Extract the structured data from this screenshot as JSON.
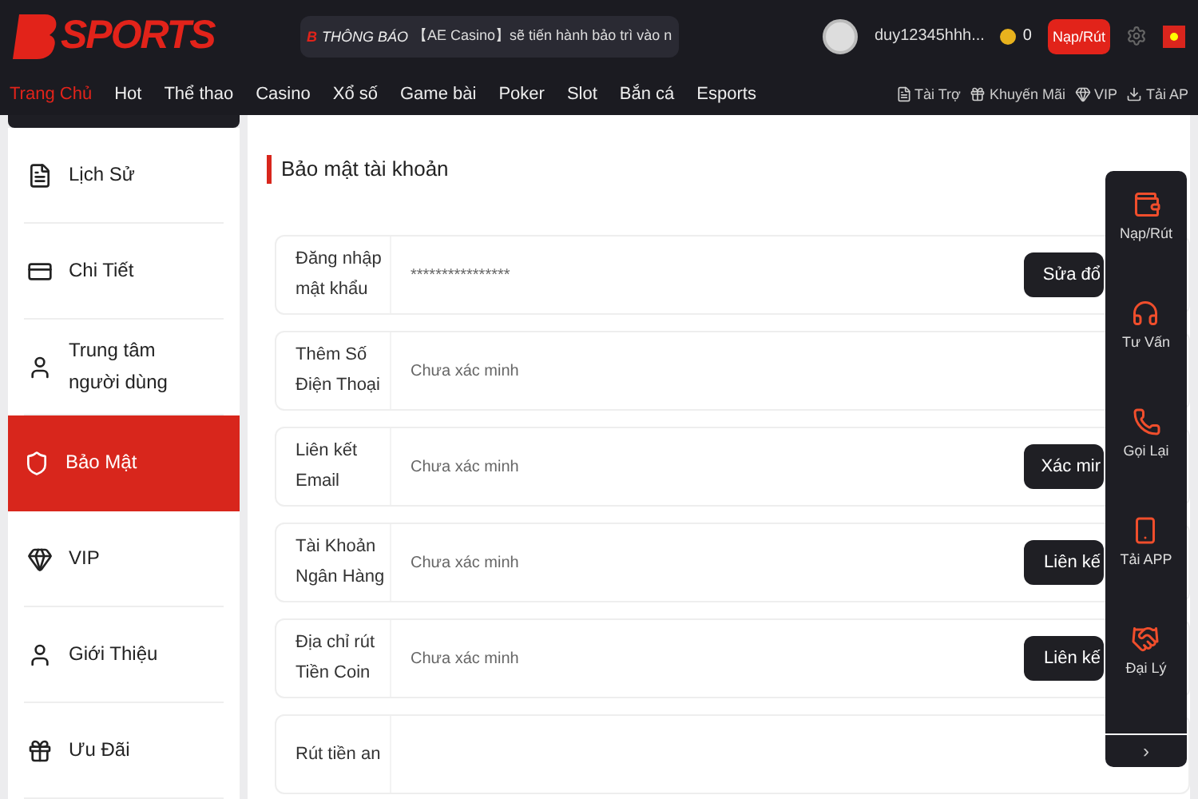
{
  "header": {
    "logo": "SPORTS",
    "notice": {
      "mark": "B",
      "label": "THÔNG BÁO",
      "text": "【AE Casino】sẽ tiến hành bảo trì vào n"
    },
    "username": "duy12345hhh...",
    "balance": "0",
    "deposit_button": "Nạp/Rút"
  },
  "nav": {
    "items": [
      {
        "label": "Trang Chủ",
        "selected": true
      },
      {
        "label": "Hot",
        "selected": false
      },
      {
        "label": "Thể thao",
        "selected": false
      },
      {
        "label": "Casino",
        "selected": false
      },
      {
        "label": "Xổ số",
        "selected": false
      },
      {
        "label": "Game bài",
        "selected": false
      },
      {
        "label": "Poker",
        "selected": false
      },
      {
        "label": "Slot",
        "selected": false
      },
      {
        "label": "Bắn cá",
        "selected": false
      },
      {
        "label": "Esports",
        "selected": false
      }
    ],
    "links": [
      "Tài Trợ",
      "Khuyến Mãi",
      "VIP",
      "Tải AP"
    ]
  },
  "sidebar": {
    "items": [
      {
        "label": "Lịch Sử",
        "selected": false
      },
      {
        "label": "Chi Tiết",
        "selected": false
      },
      {
        "label": "Trung tâm người dùng",
        "selected": false
      },
      {
        "label": "Bảo Mật",
        "selected": true
      },
      {
        "label": "VIP",
        "selected": false
      },
      {
        "label": "Giới Thiệu",
        "selected": false
      },
      {
        "label": "Ưu Đãi",
        "selected": false
      }
    ]
  },
  "section": {
    "title": "Bảo mật tài khoản",
    "rows": [
      {
        "label": "Đăng nhập mật khẩu",
        "value": "****************",
        "button": "Sửa đổ"
      },
      {
        "label": "Thêm Số Điện Thoại",
        "value": "Chưa xác minh"
      },
      {
        "label": "Liên kết Email",
        "value": "Chưa xác minh",
        "button": "Xác mir"
      },
      {
        "label": "Tài Khoản Ngân Hàng",
        "value": "Chưa xác minh",
        "button": "Liên kế"
      },
      {
        "label": "Địa chỉ rút Tiền Coin",
        "value": "Chưa xác minh",
        "button": "Liên kế"
      },
      {
        "label": "Rút tiền an"
      }
    ]
  },
  "float_panel": {
    "items": [
      "Nạp/Rút",
      "Tư Vấn",
      "Gọi Lại",
      "Tải APP",
      "Đại Lý"
    ],
    "more": "›"
  }
}
